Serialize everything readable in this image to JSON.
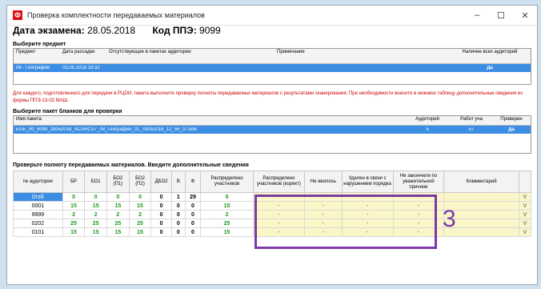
{
  "window": {
    "title": "Проверка комплектности передаваемых материалов",
    "app_icon": "app-icon",
    "controls": [
      "–",
      "☐",
      "✕"
    ]
  },
  "exam": {
    "date_label": "Дата экзамена:",
    "date_value": "28.05.2018",
    "ppe_label": "Код ППЭ:",
    "ppe_value": "9099"
  },
  "subject_section": {
    "title": "Выберите предмет",
    "headers": [
      "Предмет",
      "Дата рассадки",
      "Отсутствующие в пакетах аудитории",
      "Примечание",
      "Наличие всех аудиторий"
    ],
    "row": [
      "08 - География",
      "03.05.2018 19:32",
      "",
      "",
      "Да"
    ]
  },
  "warning": "Для каждого, подготовленного для передачи в РЦОИ, пакета выполните проверку полноты передаваемых материалов с результатами сканирования. При необходимости внесите в нижнюю таблицу дополнительные сведения из формы ППЭ-13-02 МАШ.",
  "package_section": {
    "title": "Выберите пакет бланков для проверки",
    "headers": [
      "Имя пакета",
      "Аудиторий",
      "Работ уча",
      "Проверен"
    ],
    "row": [
      "EGE_90_9099_28052018_ACSRCS7_08_География_01_03052018_12_56_07.bnk",
      "5",
      "57",
      "Да"
    ]
  },
  "check_section": {
    "title": "Проверьте полноту передаваемых материалов. Введите дополнительные сведения",
    "headers": [
      "№ аудитории",
      "БР",
      "БО1",
      "БО2 (П1)",
      "БО2 (П2)",
      "ДБО2",
      "В",
      "Ф",
      "Распределено участников",
      "Распределено участников (корект)",
      "Не явилось",
      "Удален в связи с нарушением порядка",
      "Не закончили по уважительной причине",
      "Комментарий",
      ""
    ],
    "rows": [
      [
        "0тэб",
        "0",
        "0",
        "0",
        "0",
        "0",
        "1",
        "29",
        "0",
        "-",
        "-",
        "-",
        "-",
        "",
        "V"
      ],
      [
        "0001",
        "15",
        "15",
        "15",
        "15",
        "0",
        "0",
        "0",
        "15",
        "-",
        "-",
        "-",
        "-",
        "",
        "V"
      ],
      [
        "9999",
        "2",
        "2",
        "2",
        "2",
        "0",
        "0",
        "0",
        "2",
        "-",
        "-",
        "-",
        "-",
        "",
        "V"
      ],
      [
        "0202",
        "25",
        "25",
        "25",
        "25",
        "0",
        "0",
        "0",
        "25",
        "-",
        "-",
        "-",
        "-",
        "",
        "V"
      ],
      [
        "0101",
        "15",
        "15",
        "15",
        "15",
        "0",
        "0",
        "0",
        "15",
        "-",
        "-",
        "-",
        "-",
        "",
        "V"
      ]
    ]
  },
  "annotation": "3",
  "colors": {
    "selection": "#3c8ee4",
    "warning": "#cc0000",
    "highlight": "#7b3aa5",
    "yellow_cell": "#fbf6c8",
    "green_value": "#1c9a1c"
  }
}
